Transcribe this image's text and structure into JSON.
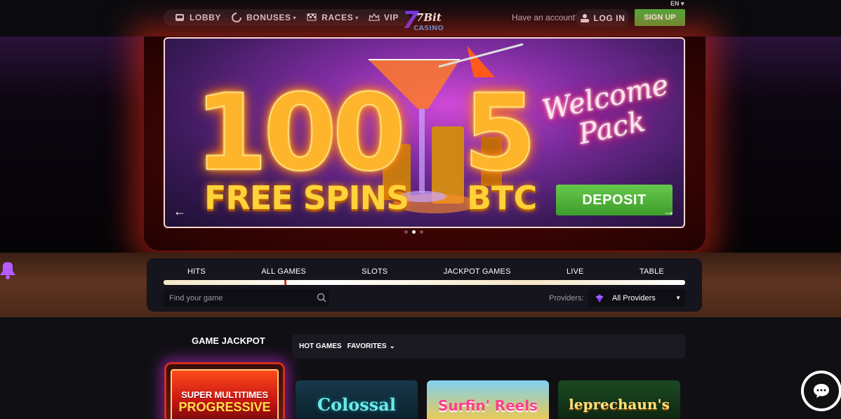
{
  "header": {
    "lang": "EN",
    "nav": [
      {
        "label": "LOBBY",
        "icon": "slot-icon"
      },
      {
        "label": "BONUSES",
        "icon": "gift-icon",
        "dropdown": true
      },
      {
        "label": "RACES",
        "icon": "flag-icon",
        "dropdown": true
      },
      {
        "label": "VIP",
        "icon": "crown-icon"
      }
    ],
    "logo_text_top": "7Bit",
    "logo_text_bottom": "CASINO",
    "have_account": "Have an account?",
    "login_label": "LOG IN",
    "signup_label": "SIGN UP"
  },
  "banner": {
    "number_left": "100",
    "number_right": "5",
    "free_spins": "FREE SPINS",
    "btc": "BTC",
    "welcome_line1": "Welcome",
    "welcome_line2": "Pack",
    "deposit_label": "DEPOSIT",
    "arrow_left": "←",
    "arrow_right": "→",
    "dots_total": 3,
    "dots_active": 2
  },
  "filters": {
    "tabs": [
      "HITS",
      "ALL GAMES",
      "SLOTS",
      "JACKPOT GAMES",
      "LIVE",
      "TABLE"
    ],
    "active_tab": "ALL GAMES",
    "search_placeholder": "Find your game",
    "providers_label": "Providers:",
    "providers_value": "All Providers"
  },
  "games": {
    "jackpot_title": "GAME JACKPOT",
    "jackpot_line1": "SUPER MULTITIMES",
    "jackpot_line2": "PROGRESSIVE",
    "subtabs": [
      "HOT GAMES",
      "FAVORITES"
    ],
    "tiles": [
      "Colossal",
      "Surfin' Reels",
      "leprechaun's"
    ]
  },
  "colors": {
    "accent_green": "#4bae3d",
    "glow_red": "#d12f1d",
    "neon_orange": "#ffb52b"
  }
}
